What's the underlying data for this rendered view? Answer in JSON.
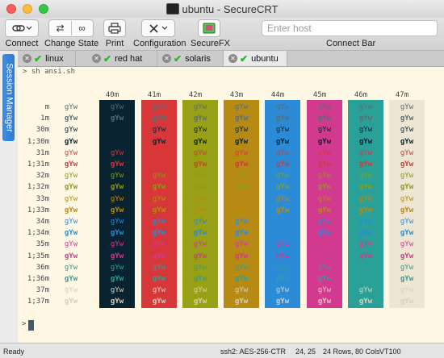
{
  "window": {
    "title": "ubuntu - SecureCRT"
  },
  "toolbar": {
    "connect": "Connect",
    "change_state": "Change State",
    "print": "Print",
    "configuration": "Configuration",
    "securefx": "SecureFX",
    "connect_bar_label": "Connect Bar",
    "connect_host_placeholder": "Enter host"
  },
  "side_tab": "Session Manager",
  "tabs": [
    {
      "label": "linux",
      "active": false
    },
    {
      "label": "red hat",
      "active": false
    },
    {
      "label": "solaris",
      "active": false
    },
    {
      "label": "ubuntu",
      "active": true
    }
  ],
  "terminal": {
    "prompt": "sh ansi.sh",
    "sample_text": "gYw",
    "fg_codes": [
      "m",
      "1m",
      "30m",
      "1;30m",
      "31m",
      "1;31m",
      "32m",
      "1;32m",
      "33m",
      "1;33m",
      "34m",
      "1;34m",
      "35m",
      "1;35m",
      "36m",
      "1;36m",
      "37m",
      "1;37m"
    ],
    "bg_columns": [
      {
        "code": "40m",
        "color": "#0a2330"
      },
      {
        "code": "41m",
        "color": "#d8373a"
      },
      {
        "code": "42m",
        "color": "#99a014"
      },
      {
        "code": "43m",
        "color": "#b78a14"
      },
      {
        "code": "44m",
        "color": "#2b8bd6"
      },
      {
        "code": "45m",
        "color": "#d13a8e"
      },
      {
        "code": "46m",
        "color": "#2aa198"
      },
      {
        "code": "47m",
        "color": "#ece6d2"
      }
    ],
    "fg_colors": {
      "default": "#5a6d75",
      "30": "#0a2330",
      "31": "#d8373a",
      "32": "#8a9d10",
      "33": "#b78a14",
      "34": "#2b8bd6",
      "35": "#d13a8e",
      "36": "#2aa198",
      "37": "#d7d0bd"
    },
    "cursor_prompt": ">"
  },
  "statusbar": {
    "ready": "Ready",
    "encryption": "ssh2: AES-256-CTR",
    "position": "24, 25",
    "size": "24 Rows, 80 Cols",
    "emulation": "VT100"
  }
}
